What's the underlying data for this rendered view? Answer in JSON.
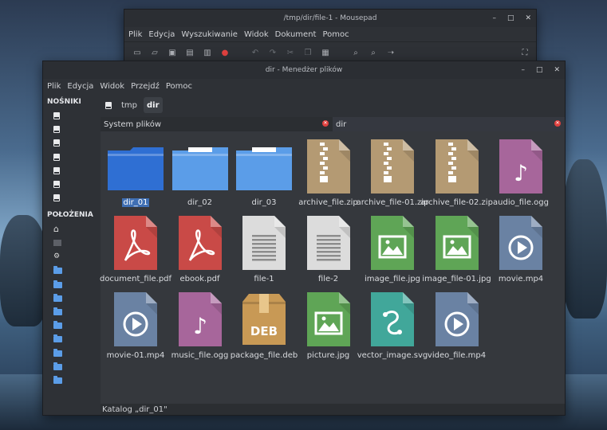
{
  "mousepad": {
    "title": "/tmp/dir/file-1 - Mousepad",
    "menu": [
      "Plik",
      "Edycja",
      "Wyszukiwanie",
      "Widok",
      "Dokument",
      "Pomoc"
    ]
  },
  "filemanager": {
    "title": "dir - Menedżer plików",
    "menu": [
      "Plik",
      "Edycja",
      "Widok",
      "Przejdź",
      "Pomoc"
    ],
    "sidebar": {
      "devices_header": "NOŚNIKI",
      "places_header": "POŁOŻENIA",
      "device_count": 7,
      "places": [
        "home-icon",
        "desktop-icon",
        "trash-icon",
        "folder-icon",
        "folder-icon",
        "folder-icon",
        "folder-icon",
        "folder-icon",
        "folder-icon",
        "folder-icon",
        "folder-icon",
        "folder-icon"
      ]
    },
    "pathbar": [
      "tmp",
      "dir"
    ],
    "tabs": [
      "System plików",
      "dir"
    ],
    "files": [
      {
        "name": "dir_01",
        "type": "folder-dark",
        "selected": true
      },
      {
        "name": "dir_02",
        "type": "folder"
      },
      {
        "name": "dir_03",
        "type": "folder"
      },
      {
        "name": "archive_file.zip",
        "type": "zip"
      },
      {
        "name": "archive_file-01.zip",
        "type": "zip"
      },
      {
        "name": "archive_file-02.zip",
        "type": "zip"
      },
      {
        "name": "audio_file.ogg",
        "type": "audio"
      },
      {
        "name": "document_file.pdf",
        "type": "pdf"
      },
      {
        "name": "ebook.pdf",
        "type": "pdf"
      },
      {
        "name": "file-1",
        "type": "text"
      },
      {
        "name": "file-2",
        "type": "text"
      },
      {
        "name": "image_file.jpg",
        "type": "image"
      },
      {
        "name": "image_file-01.jpg",
        "type": "image"
      },
      {
        "name": "movie.mp4",
        "type": "video"
      },
      {
        "name": "movie-01.mp4",
        "type": "video"
      },
      {
        "name": "music_file.ogg",
        "type": "audio"
      },
      {
        "name": "package_file.deb",
        "type": "deb"
      },
      {
        "name": "picture.jpg",
        "type": "image"
      },
      {
        "name": "vector_image.svg",
        "type": "vector"
      },
      {
        "name": "video_file.mp4",
        "type": "video"
      }
    ],
    "status": "Katalog „dir_01\""
  },
  "colors": {
    "folder": "#5b9de8",
    "folder_dark": "#2f6fd3",
    "zip": "#b49a73",
    "audio": "#a7669b",
    "pdf": "#c94a47",
    "text": "#dcdcdc",
    "image": "#5fa556",
    "video": "#6a82a3",
    "deb": "#c89955",
    "vector": "#41a79a"
  }
}
